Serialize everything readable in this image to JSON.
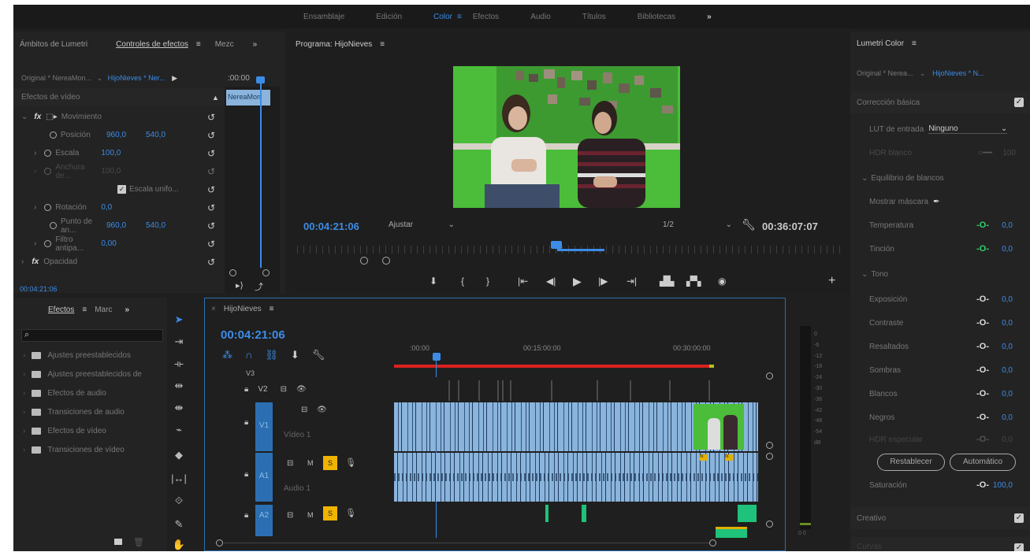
{
  "workspaces": {
    "items": [
      "Ensamblaje",
      "Edición",
      "Color",
      "Efectos",
      "Audio",
      "Títulos",
      "Bibliotecas"
    ],
    "active": "Color",
    "more": "»"
  },
  "ec_panel": {
    "tabs": [
      "Ámbitos de Lumetri",
      "Controles de efectos",
      "Mezc"
    ],
    "active_tab": "Controles de efectos",
    "source": "Original * NereaMon...",
    "sequence": "HijoNieves * Ner...",
    "ruler_time": ":00:00",
    "clip_label": "NereaMon",
    "section": "Efectos de vídeo",
    "motion": "Movimiento",
    "position_label": "Posición",
    "position_x": "960,0",
    "position_y": "540,0",
    "scale_label": "Escala",
    "scale_value": "100,0",
    "width_label": "Anchura de...",
    "width_value": "100,0",
    "uniform_label": "Escala unifo...",
    "rotation_label": "Rotación",
    "rotation_value": "0,0",
    "anchor_label": "Punto de an...",
    "anchor_x": "960,0",
    "anchor_y": "540,0",
    "filter_label": "Filtro antipa...",
    "filter_value": "0,00",
    "opacity_label": "Opacidad",
    "footer_time": "00:04:21:06"
  },
  "program": {
    "title": "Programa: HijoNieves",
    "timecode": "00:04:21:06",
    "fit": "Ajustar",
    "resolution": "1/2",
    "duration": "00:36:07:07"
  },
  "effects_panel": {
    "tabs": [
      "Efectos",
      "Marc"
    ],
    "items": [
      "Ajustes preestablecidos",
      "Ajustes preestablecidos de",
      "Efectos de audio",
      "Transiciones de audio",
      "Efectos de vídeo",
      "Transiciones de vídeo"
    ]
  },
  "timeline": {
    "title": "HijoNieves",
    "timecode": "00:04:21:06",
    "ruler": [
      ":00:00",
      "00:15:00:00",
      "00:30:00:00"
    ],
    "tracks": {
      "v3": "V3",
      "v2": "V2",
      "v1": "V1",
      "v1_name": "Vídeo 1",
      "a1": "A1",
      "a1_name": "Audio 1",
      "a2": "A2",
      "m": "M",
      "s": "S"
    }
  },
  "meter": {
    "scale": [
      "0",
      "-6",
      "-12",
      "-18",
      "-24",
      "-30",
      "-36",
      "-42",
      "-48",
      "-54",
      "dB"
    ],
    "footer": "0 0"
  },
  "lumetri": {
    "title": "Lumetri Color",
    "source": "Original * Nerea...",
    "sequence": "HijoNieves * N...",
    "basic": "Corrección básica",
    "lut_label": "LUT de entrada",
    "lut_value": "Ninguno",
    "hdr_white": "HDR blanco",
    "hdr_white_val": "100",
    "wb": "Equilibrio de blancos",
    "mask": "Mostrar máscara",
    "rows": [
      {
        "label": "Temperatura",
        "value": "0,0"
      },
      {
        "label": "Tinción",
        "value": "0,0"
      }
    ],
    "tone": "Tono",
    "tone_rows": [
      {
        "label": "Exposición",
        "value": "0,0"
      },
      {
        "label": "Contraste",
        "value": "0,0"
      },
      {
        "label": "Resaltados",
        "value": "0,0"
      },
      {
        "label": "Sombras",
        "value": "0,0"
      },
      {
        "label": "Blancos",
        "value": "0,0"
      },
      {
        "label": "Negros",
        "value": "0,0"
      },
      {
        "label": "HDR especular",
        "value": "0,0"
      }
    ],
    "reset": "Restablecer",
    "auto": "Automático",
    "saturation": "Saturación",
    "saturation_value": "100,0",
    "creative": "Creativo",
    "curves": "Curvas"
  },
  "colors": {
    "accent": "#3c8ce7",
    "green": "#2fd46a",
    "solo": "#f0b400",
    "clip": "#8ab4dc",
    "audio_green": "#1fc27a"
  }
}
